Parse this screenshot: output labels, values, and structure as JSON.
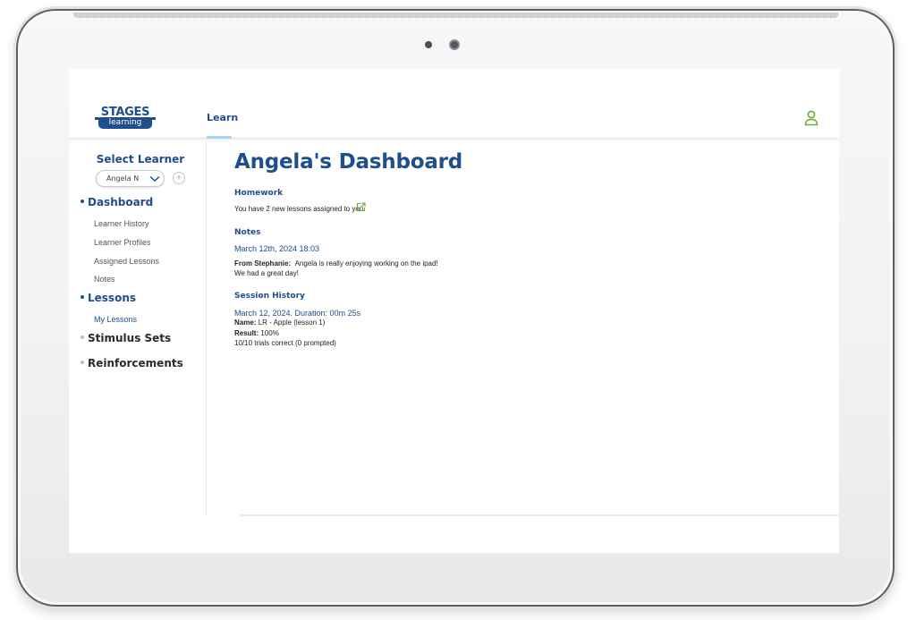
{
  "app": {
    "logo_top": "STAGES",
    "logo_bottom": "learning",
    "nav_tab": "Learn"
  },
  "sidebar": {
    "select_title": "Select Learner",
    "selected_learner": "Angela N",
    "add_label": "+",
    "sections": [
      {
        "label": "Dashboard",
        "active": true,
        "items": [
          "Learner History",
          "Learner Profiles",
          "Assigned Lessons",
          "Notes"
        ]
      },
      {
        "label": "Lessons",
        "active": true,
        "items": [
          "My Lessons"
        ]
      },
      {
        "label": "Stimulus Sets",
        "active": false,
        "items": []
      },
      {
        "label": "Reinforcements",
        "active": false,
        "items": []
      }
    ]
  },
  "main": {
    "title": "Angela's Dashboard",
    "homework": {
      "heading": "Homework",
      "text": "You have 2 new lessons assigned to you."
    },
    "notes": {
      "heading": "Notes",
      "date": "March 12th, 2024 18:03",
      "from_label": "From Stephanie:",
      "line1": "Angela is really enjoying working on the ipad!",
      "line2": "We had a great day!"
    },
    "session_history": {
      "heading": "Session History",
      "summary": "March 12, 2024. Duration: 00m 25s",
      "name_label": "Name:",
      "name_value": "LR - Apple (lesson 1)",
      "result_label": "Result:",
      "result_value": "100%",
      "trials": "10/10 trials correct (0 prompted)"
    }
  },
  "colors": {
    "brand_blue": "#1e4e8c",
    "accent_green": "#6aab3c",
    "tab_underline": "#a9d3f2"
  }
}
